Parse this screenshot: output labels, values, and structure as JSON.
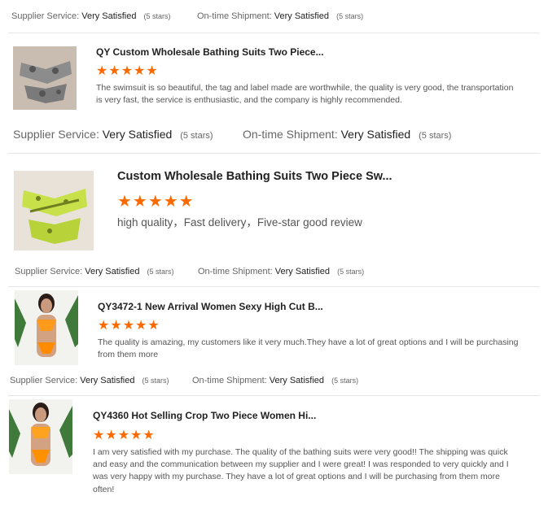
{
  "colors": {
    "star": "#ff6a00",
    "divider": "#e6e6e6",
    "text": "#555555"
  },
  "reviews": [
    {
      "supplier_label": "Supplier Service:",
      "supplier_value": "Very Satisfied",
      "supplier_stars": "(5 stars)",
      "shipment_label": "On-time Shipment:",
      "shipment_value": "Very Satisfied",
      "shipment_stars": "(5 stars)"
    },
    {
      "title": "QY Custom Wholesale Bathing Suits Two Piece...",
      "stars": "★★★★★",
      "text": "The swimsuit is so beautiful, the tag and label made are worthwhile, the quality is very good, the transportation is very fast, the service is enthusiastic, and the company is highly recommended.",
      "supplier_label": "Supplier Service:",
      "supplier_value": "Very Satisfied",
      "supplier_stars": "(5 stars)",
      "shipment_label": "On-time Shipment:",
      "shipment_value": "Very Satisfied",
      "shipment_stars": "(5 stars)"
    },
    {
      "title": "Custom Wholesale Bathing Suits Two Piece Sw...",
      "stars": "★★★★★",
      "text": "high quality，Fast delivery，Five-star good review",
      "supplier_label": "Supplier Service:",
      "supplier_value": "Very Satisfied",
      "supplier_stars": "(5 stars)",
      "shipment_label": "On-time Shipment:",
      "shipment_value": "Very Satisfied",
      "shipment_stars": "(5 stars)"
    },
    {
      "title": "QY3472-1 New Arrival Women Sexy High Cut B...",
      "stars": "★★★★★",
      "text": "The quality is amazing, my customers like it very much.They have a lot of great options and I will be purchasing from them more",
      "supplier_label": "Supplier Service:",
      "supplier_value": "Very Satisfied",
      "supplier_stars": "(5 stars)",
      "shipment_label": "On-time Shipment:",
      "shipment_value": "Very Satisfied",
      "shipment_stars": "(5 stars)"
    },
    {
      "title": "QY4360 Hot Selling Crop Two Piece Women Hi...",
      "stars": "★★★★★",
      "text": "I am very satisfied with my purchase. The quality of the bathing suits were very good!! The shipping was quick and easy and the communication between my supplier and I were great! I was responded to very quickly and I was very happy with my purchase. They have a lot of great options and I will be purchasing from them more often!"
    }
  ]
}
